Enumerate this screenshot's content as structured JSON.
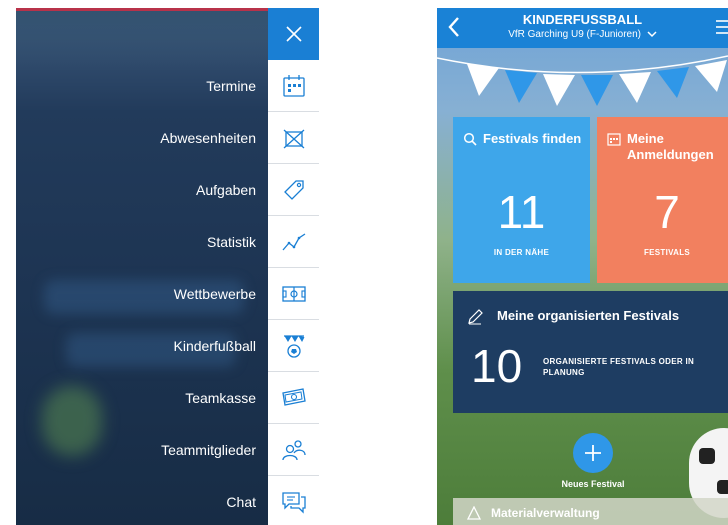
{
  "side_menu": {
    "close_icon": "close-icon",
    "items": [
      {
        "label": "Termine",
        "icon": "calendar-icon"
      },
      {
        "label": "Abwesenheiten",
        "icon": "absence-icon"
      },
      {
        "label": "Aufgaben",
        "icon": "tag-icon"
      },
      {
        "label": "Statistik",
        "icon": "chart-line-icon"
      },
      {
        "label": "Wettbewerbe",
        "icon": "pitch-icon"
      },
      {
        "label": "Kinderfußball",
        "icon": "ball-bunting-icon"
      },
      {
        "label": "Teamkasse",
        "icon": "money-icon"
      },
      {
        "label": "Teammitglieder",
        "icon": "team-members-icon"
      },
      {
        "label": "Chat",
        "icon": "chat-icon"
      }
    ],
    "colors": {
      "close_bg": "#1a7fd4",
      "icon_blue": "#1a7fd4",
      "top_line": "#b8324a"
    }
  },
  "kinder": {
    "header": {
      "title": "KINDERFUSSBALL",
      "subtitle": "VfR Garching U9 (F-Junioren)",
      "back_icon": "chevron-left-icon",
      "dropdown_icon": "chevron-down-icon",
      "menu_icon": "hamburger-icon"
    },
    "festivals_tile": {
      "heading": "Festivals finden",
      "count": "11",
      "caption": "IN DER NÄHE",
      "icon": "search-icon",
      "color": "#3ea6ea"
    },
    "registrations_tile": {
      "heading": "Meine Anmeldungen",
      "count": "7",
      "caption": "FESTIVALS",
      "icon": "calendar-icon",
      "color": "#f2805f"
    },
    "organized": {
      "title": "Meine organisierten Festivals",
      "count": "10",
      "caption": "ORGANISIERTE FESTIVALS ODER IN PLANUNG",
      "icon": "pencil-icon",
      "color": "#1e3d62"
    },
    "new_festival": {
      "label": "Neues Festival",
      "icon": "plus-icon"
    },
    "bottom": {
      "label": "Materialverwaltung",
      "icon": "material-icon"
    }
  }
}
